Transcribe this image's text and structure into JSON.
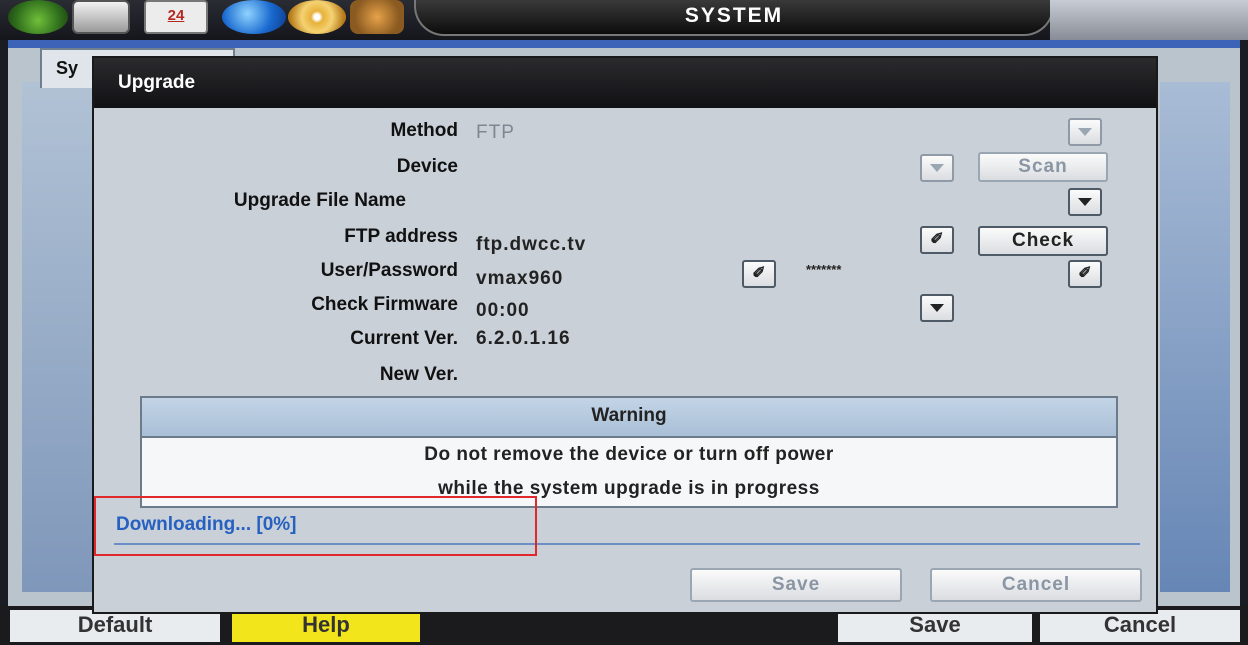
{
  "topbar": {
    "calendar_label": "24",
    "title": "SYSTEM"
  },
  "background": {
    "tab_label": "Sy",
    "buttons": {
      "default": "Default",
      "help": "Help",
      "save": "Save",
      "cancel": "Cancel"
    }
  },
  "dialog": {
    "title": "Upgrade",
    "fields": {
      "method_label": "Method",
      "method_value": "FTP",
      "device_label": "Device",
      "device_value": "",
      "file_label": "Upgrade File Name",
      "file_value": "",
      "ftp_label": "FTP address",
      "ftp_value": "ftp.dwcc.tv",
      "user_label": "User/Password",
      "user_value": "vmax960",
      "password_value": "*******",
      "check_label": "Check Firmware",
      "check_value": "00:00",
      "current_label": "Current Ver.",
      "current_value": "6.2.0.1.16",
      "new_label": "New Ver.",
      "new_value": ""
    },
    "buttons": {
      "scan": "Scan",
      "check": "Check",
      "save": "Save",
      "cancel": "Cancel",
      "edit_glyph": "✐"
    },
    "warning": {
      "title": "Warning",
      "line1": "Do not remove the device or turn off power",
      "line2": "while the system upgrade is in progress"
    },
    "progress": {
      "text": "Downloading... [0%]",
      "percent": 0
    }
  },
  "colors": {
    "highlight_border": "#e0282a",
    "progress_text": "#2660c0",
    "help_button": "#f2e51c"
  }
}
